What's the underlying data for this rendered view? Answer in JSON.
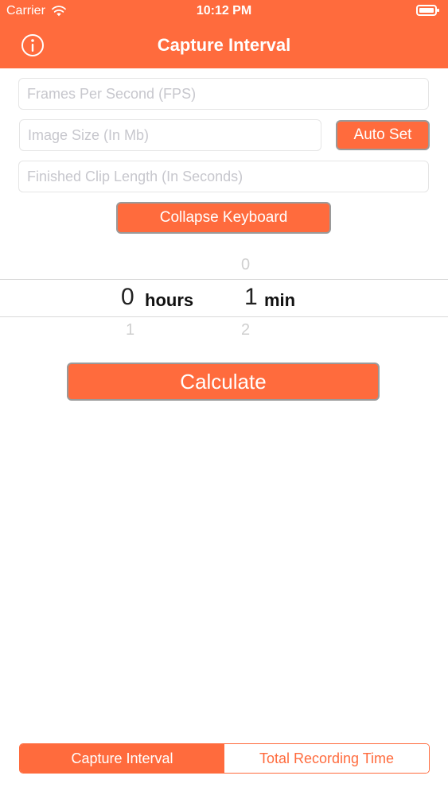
{
  "status": {
    "carrier": "Carrier",
    "time": "10:12 PM"
  },
  "nav": {
    "title": "Capture Interval",
    "info_icon": "info-icon"
  },
  "form": {
    "fps_placeholder": "Frames Per Second (FPS)",
    "image_size_placeholder": "Image Size (In Mb)",
    "auto_set_label": "Auto Set",
    "clip_length_placeholder": "Finished Clip Length (In Seconds)",
    "collapse_keyboard_label": "Collapse Keyboard"
  },
  "picker": {
    "hours_prev": "",
    "hours_selected": "0",
    "hours_next": "1",
    "hours_unit": "hours",
    "min_prev": "0",
    "min_selected": "1",
    "min_next": "2",
    "min_unit": "min"
  },
  "actions": {
    "calculate_label": "Calculate"
  },
  "segment": {
    "left": "Capture Interval",
    "right": "Total Recording Time"
  },
  "colors": {
    "accent": "#FF6B3D"
  }
}
